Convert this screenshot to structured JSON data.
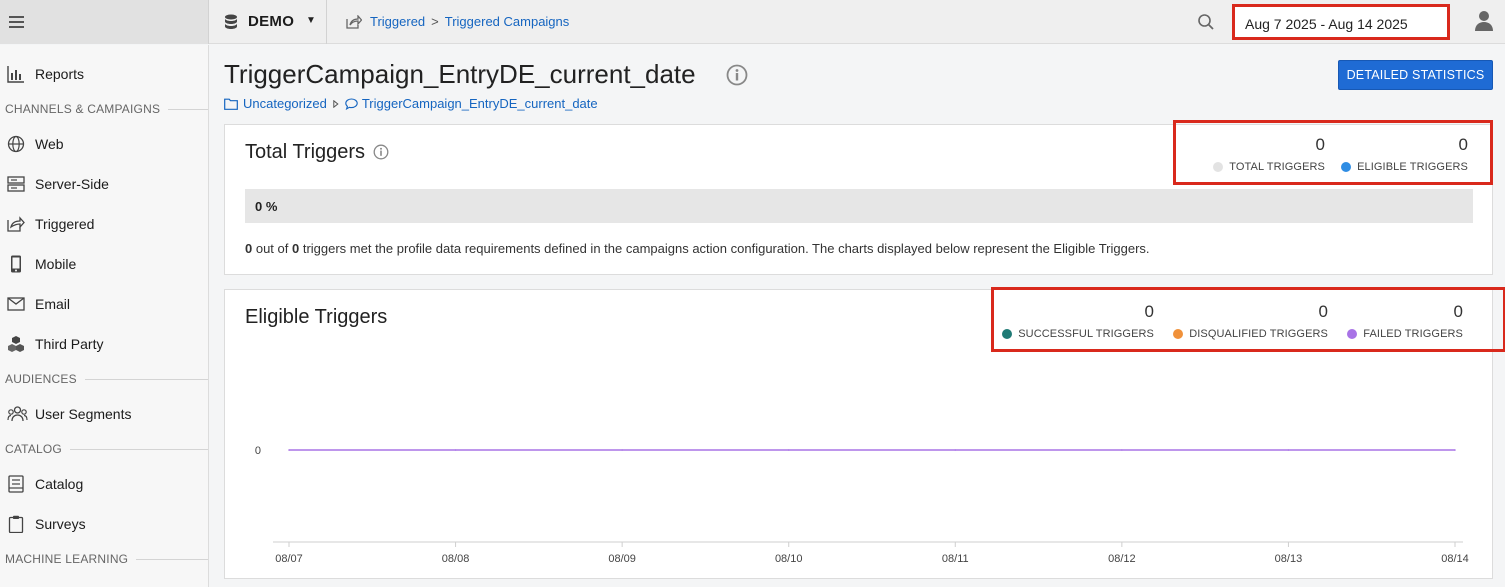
{
  "topbar": {
    "account_name": "DEMO",
    "breadcrumb": [
      "Triggered",
      "Triggered Campaigns"
    ],
    "breadcrumb_sep": ">",
    "date_range": "Aug 7 2025 - Aug 14 2025"
  },
  "sidebar": {
    "items": [
      {
        "label": "Reports",
        "icon": "bar-chart-icon"
      },
      {
        "section": "CHANNELS & CAMPAIGNS"
      },
      {
        "label": "Web",
        "icon": "globe-icon"
      },
      {
        "label": "Server-Side",
        "icon": "server-icon"
      },
      {
        "label": "Triggered",
        "icon": "share-icon"
      },
      {
        "label": "Mobile",
        "icon": "mobile-icon"
      },
      {
        "label": "Email",
        "icon": "envelope-icon"
      },
      {
        "label": "Third Party",
        "icon": "cubes-icon"
      },
      {
        "section": "AUDIENCES"
      },
      {
        "label": "User Segments",
        "icon": "users-icon"
      },
      {
        "section": "CATALOG"
      },
      {
        "label": "Catalog",
        "icon": "book-icon"
      },
      {
        "label": "Surveys",
        "icon": "clipboard-icon"
      },
      {
        "section": "MACHINE LEARNING"
      }
    ]
  },
  "main": {
    "title": "TriggerCampaign_EntryDE_current_date",
    "detail_button": "DETAILED STATISTICS",
    "breadcrumb": [
      "Uncategorized",
      "TriggerCampaign_EntryDE_current_date"
    ]
  },
  "total_triggers": {
    "title": "Total Triggers",
    "stats": [
      {
        "value": "0",
        "label": "TOTAL TRIGGERS",
        "color": "#e3e3e3"
      },
      {
        "value": "0",
        "label": "ELIGIBLE TRIGGERS",
        "color": "#2f8de4"
      }
    ],
    "percent_text": "0 %",
    "percent": 0,
    "note_count_a": "0",
    "note_mid": " out of ",
    "note_count_b": "0",
    "note_rest": " triggers met the profile data requirements defined in the campaigns action configuration. The charts displayed below represent the Eligible Triggers."
  },
  "eligible_triggers": {
    "title": "Eligible Triggers",
    "stats": [
      {
        "value": "0",
        "label": "SUCCESSFUL TRIGGERS",
        "color": "#1f7a75"
      },
      {
        "value": "0",
        "label": "DISQUALIFIED TRIGGERS",
        "color": "#f0913a"
      },
      {
        "value": "0",
        "label": "FAILED TRIGGERS",
        "color": "#a873e6"
      }
    ]
  },
  "chart_data": {
    "type": "line",
    "categories": [
      "08/07",
      "08/08",
      "08/09",
      "08/10",
      "08/11",
      "08/12",
      "08/13",
      "08/14"
    ],
    "series": [
      {
        "values": [
          0,
          0,
          0,
          0,
          0,
          0,
          0,
          0
        ],
        "color": "#a873e6"
      }
    ],
    "y_ticks": [
      "0"
    ],
    "grid": false
  }
}
